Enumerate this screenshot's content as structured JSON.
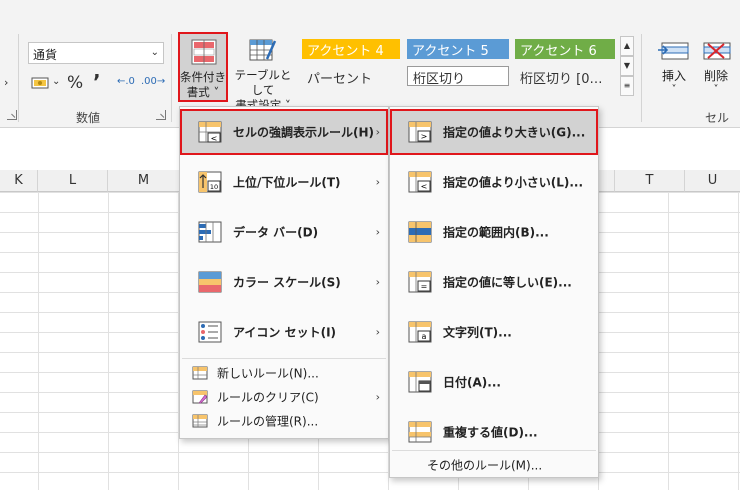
{
  "ribbon": {
    "number_format": {
      "value": "通貨"
    },
    "number_tools": {
      "percent": "%",
      "comma": "’",
      "increase_decimal": "←.0",
      "decrease_decimal": ".00→"
    },
    "groups": {
      "number": "数値",
      "cells": "セル"
    },
    "conditional_format": {
      "line1": "条件付き",
      "line2": "書式 ˅"
    },
    "format_as_table": {
      "line1": "テーブルとして",
      "line2": "書式設定 ˅"
    },
    "styles": {
      "accent4": "アクセント 4",
      "accent5": "アクセント 5",
      "accent6": "アクセント 6",
      "percent": "パーセント",
      "comma": "桁区切り",
      "comma0": "桁区切り [0…"
    },
    "insert": {
      "label": "挿入",
      "chev": "˅"
    },
    "delete": {
      "label": "削除",
      "chev": "˅"
    }
  },
  "sheet": {
    "columns": [
      "K",
      "L",
      "M",
      "T",
      "U"
    ]
  },
  "main_menu": {
    "items": [
      {
        "label": "セルの強調表示ルール(H)",
        "icon": "highlight-rules-icon"
      },
      {
        "label": "上位/下位ルール(T)",
        "icon": "top-bottom-icon"
      },
      {
        "label": "データ バー(D)",
        "icon": "data-bars-icon"
      },
      {
        "label": "カラー スケール(S)",
        "icon": "color-scales-icon"
      },
      {
        "label": "アイコン セット(I)",
        "icon": "icon-sets-icon"
      }
    ],
    "small_items": [
      {
        "label": "新しいルール(N)...",
        "icon": "new-rule-icon"
      },
      {
        "label": "ルールのクリア(C)",
        "icon": "clear-rules-icon"
      },
      {
        "label": "ルールの管理(R)...",
        "icon": "manage-rules-icon"
      }
    ]
  },
  "sub_menu": {
    "items": [
      {
        "label": "指定の値より大きい(G)...",
        "icon": "greater-than-icon",
        "glyph": ">"
      },
      {
        "label": "指定の値より小さい(L)...",
        "icon": "less-than-icon",
        "glyph": "<"
      },
      {
        "label": "指定の範囲内(B)...",
        "icon": "between-icon",
        "glyph": ""
      },
      {
        "label": "指定の値に等しい(E)...",
        "icon": "equal-to-icon",
        "glyph": "="
      },
      {
        "label": "文字列(T)...",
        "icon": "text-contains-icon",
        "glyph": "a"
      },
      {
        "label": "日付(A)...",
        "icon": "date-occurring-icon",
        "glyph": ""
      },
      {
        "label": "重複する値(D)...",
        "icon": "duplicate-values-icon",
        "glyph": ""
      }
    ],
    "more": "その他のルール(M)..."
  },
  "colors": {
    "accent4": "#ffc000",
    "accent5": "#5b9bd5",
    "accent6": "#70ad47",
    "highlight_border": "#e0161b"
  }
}
